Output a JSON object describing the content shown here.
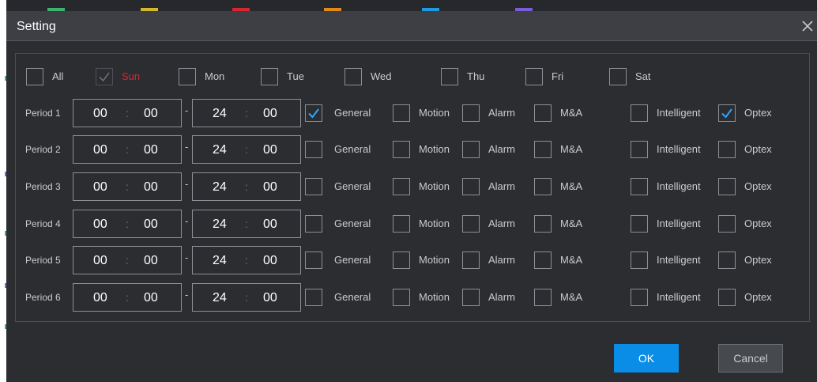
{
  "dialog": {
    "title": "Setting",
    "ok_label": "OK",
    "cancel_label": "Cancel"
  },
  "days": [
    {
      "label": "All",
      "checked": false,
      "disabled": false
    },
    {
      "label": "Sun",
      "checked": true,
      "disabled": true
    },
    {
      "label": "Mon",
      "checked": false,
      "disabled": false
    },
    {
      "label": "Tue",
      "checked": false,
      "disabled": false
    },
    {
      "label": "Wed",
      "checked": false,
      "disabled": false
    },
    {
      "label": "Thu",
      "checked": false,
      "disabled": false
    },
    {
      "label": "Fri",
      "checked": false,
      "disabled": false
    },
    {
      "label": "Sat",
      "checked": false,
      "disabled": false
    }
  ],
  "record_types": [
    "General",
    "Motion",
    "Alarm",
    "M&A",
    "Intelligent",
    "Optex"
  ],
  "periods": [
    {
      "label": "Period 1",
      "start_h": "00",
      "start_m": "00",
      "end_h": "24",
      "end_m": "00",
      "checked": [
        true,
        false,
        false,
        false,
        false,
        true
      ]
    },
    {
      "label": "Period 2",
      "start_h": "00",
      "start_m": "00",
      "end_h": "24",
      "end_m": "00",
      "checked": [
        false,
        false,
        false,
        false,
        false,
        false
      ]
    },
    {
      "label": "Period 3",
      "start_h": "00",
      "start_m": "00",
      "end_h": "24",
      "end_m": "00",
      "checked": [
        false,
        false,
        false,
        false,
        false,
        false
      ]
    },
    {
      "label": "Period 4",
      "start_h": "00",
      "start_m": "00",
      "end_h": "24",
      "end_m": "00",
      "checked": [
        false,
        false,
        false,
        false,
        false,
        false
      ]
    },
    {
      "label": "Period 5",
      "start_h": "00",
      "start_m": "00",
      "end_h": "24",
      "end_m": "00",
      "checked": [
        false,
        false,
        false,
        false,
        false,
        false
      ]
    },
    {
      "label": "Period 6",
      "start_h": "00",
      "start_m": "00",
      "end_h": "24",
      "end_m": "00",
      "checked": [
        false,
        false,
        false,
        false,
        false,
        false
      ]
    }
  ],
  "glyphs": {
    "colon": ":",
    "dash": "-"
  },
  "colors": {
    "accent": "#0a8de6",
    "check": "#2ea6ff",
    "dialog_bg": "#2b2d31",
    "titlebar_bg": "#3d3f44",
    "sun_text": "#d9262e"
  },
  "icons": {
    "close": "close-icon",
    "check": "check-icon"
  }
}
